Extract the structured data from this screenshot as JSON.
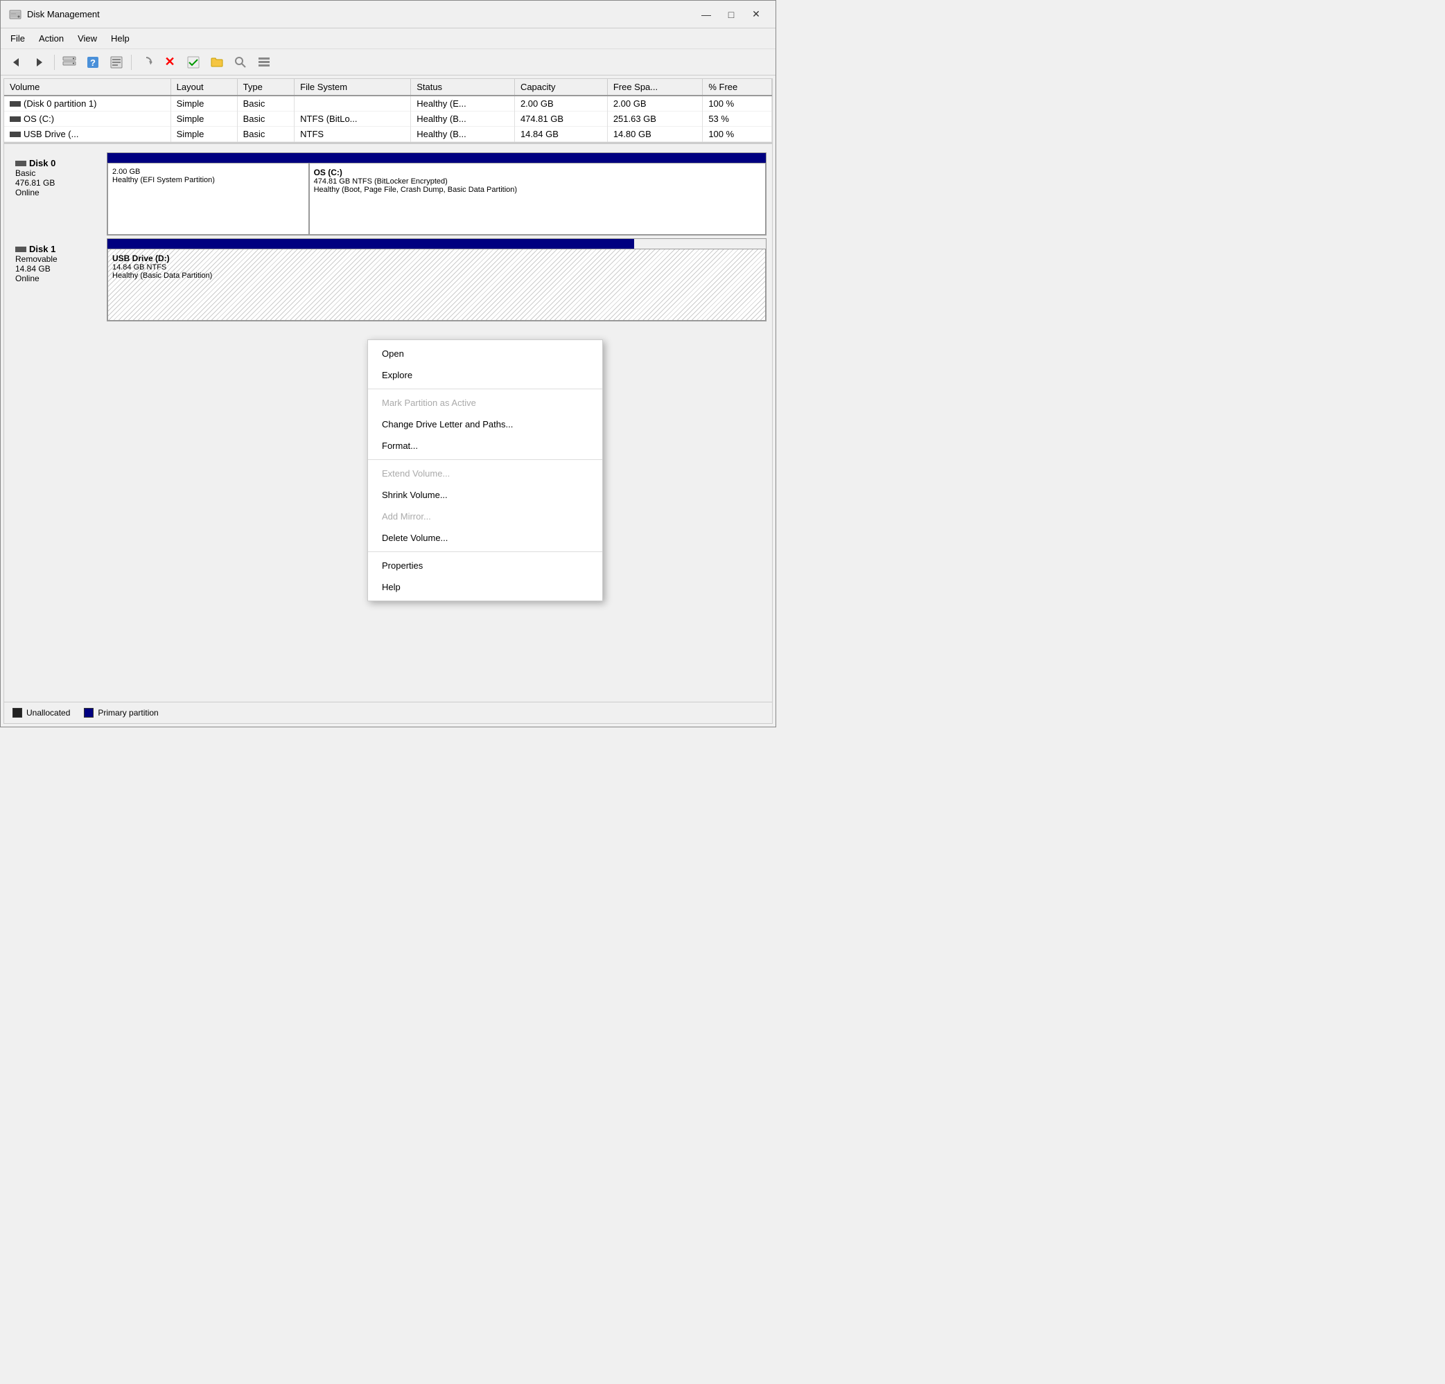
{
  "window": {
    "title": "Disk Management",
    "controls": {
      "minimize": "—",
      "maximize": "□",
      "close": "✕"
    }
  },
  "menu": {
    "items": [
      "File",
      "Action",
      "View",
      "Help"
    ]
  },
  "toolbar": {
    "buttons": [
      {
        "name": "back",
        "icon": "←"
      },
      {
        "name": "forward",
        "icon": "→"
      },
      {
        "name": "disk-list",
        "icon": "⊞"
      },
      {
        "name": "help",
        "icon": "?"
      },
      {
        "name": "properties",
        "icon": "⊡"
      },
      {
        "name": "rescan",
        "icon": "⇌"
      },
      {
        "name": "delete",
        "icon": "✕"
      },
      {
        "name": "check",
        "icon": "✓"
      },
      {
        "name": "folder",
        "icon": "📁"
      },
      {
        "name": "search",
        "icon": "🔍"
      },
      {
        "name": "view",
        "icon": "≡"
      }
    ]
  },
  "table": {
    "headers": [
      "Volume",
      "Layout",
      "Type",
      "File System",
      "Status",
      "Capacity",
      "Free Spa...",
      "% Free"
    ],
    "rows": [
      {
        "volume": "(Disk 0 partition 1)",
        "layout": "Simple",
        "type": "Basic",
        "filesystem": "",
        "status": "Healthy (E...",
        "capacity": "2.00 GB",
        "free": "2.00 GB",
        "pct_free": "100 %"
      },
      {
        "volume": "OS (C:)",
        "layout": "Simple",
        "type": "Basic",
        "filesystem": "NTFS (BitLo...",
        "status": "Healthy (B...",
        "capacity": "474.81 GB",
        "free": "251.63 GB",
        "pct_free": "53 %"
      },
      {
        "volume": "USB Drive (...",
        "layout": "Simple",
        "type": "Basic",
        "filesystem": "NTFS",
        "status": "Healthy (B...",
        "capacity": "14.84 GB",
        "free": "14.80 GB",
        "pct_free": "100 %"
      }
    ]
  },
  "disks": [
    {
      "name": "Disk 0",
      "type": "Basic",
      "size": "476.81 GB",
      "status": "Online",
      "partitions": [
        {
          "label": "",
          "size": "2.00 GB",
          "description": "Healthy (EFI System Partition)",
          "style": "normal",
          "width_pct": 30
        },
        {
          "label": "OS  (C:)",
          "size": "474.81 GB NTFS (BitLocker Encrypted)",
          "description": "Healthy (Boot, Page File, Crash Dump, Basic Data Partition)",
          "style": "normal",
          "width_pct": 70
        }
      ]
    },
    {
      "name": "Disk 1",
      "type": "Removable",
      "size": "14.84 GB",
      "status": "Online",
      "partitions": [
        {
          "label": "USB Drive  (D:)",
          "size": "14.84 GB NTFS",
          "description": "Healthy (Basic Data Partition)",
          "style": "hatch",
          "width_pct": 100
        }
      ]
    }
  ],
  "context_menu": {
    "items": [
      {
        "label": "Open",
        "enabled": true,
        "separator_after": false
      },
      {
        "label": "Explore",
        "enabled": true,
        "separator_after": true
      },
      {
        "label": "Mark Partition as Active",
        "enabled": false,
        "separator_after": false
      },
      {
        "label": "Change Drive Letter and Paths...",
        "enabled": true,
        "separator_after": false
      },
      {
        "label": "Format...",
        "enabled": true,
        "separator_after": true
      },
      {
        "label": "Extend Volume...",
        "enabled": false,
        "separator_after": false
      },
      {
        "label": "Shrink Volume...",
        "enabled": true,
        "separator_after": false
      },
      {
        "label": "Add Mirror...",
        "enabled": false,
        "separator_after": false
      },
      {
        "label": "Delete Volume...",
        "enabled": true,
        "separator_after": true
      },
      {
        "label": "Properties",
        "enabled": true,
        "separator_after": false
      },
      {
        "label": "Help",
        "enabled": true,
        "separator_after": false
      }
    ]
  },
  "legend": {
    "items": [
      {
        "label": "Unallocated",
        "color": "#222"
      },
      {
        "label": "Primary partition",
        "color": "navy"
      }
    ]
  }
}
